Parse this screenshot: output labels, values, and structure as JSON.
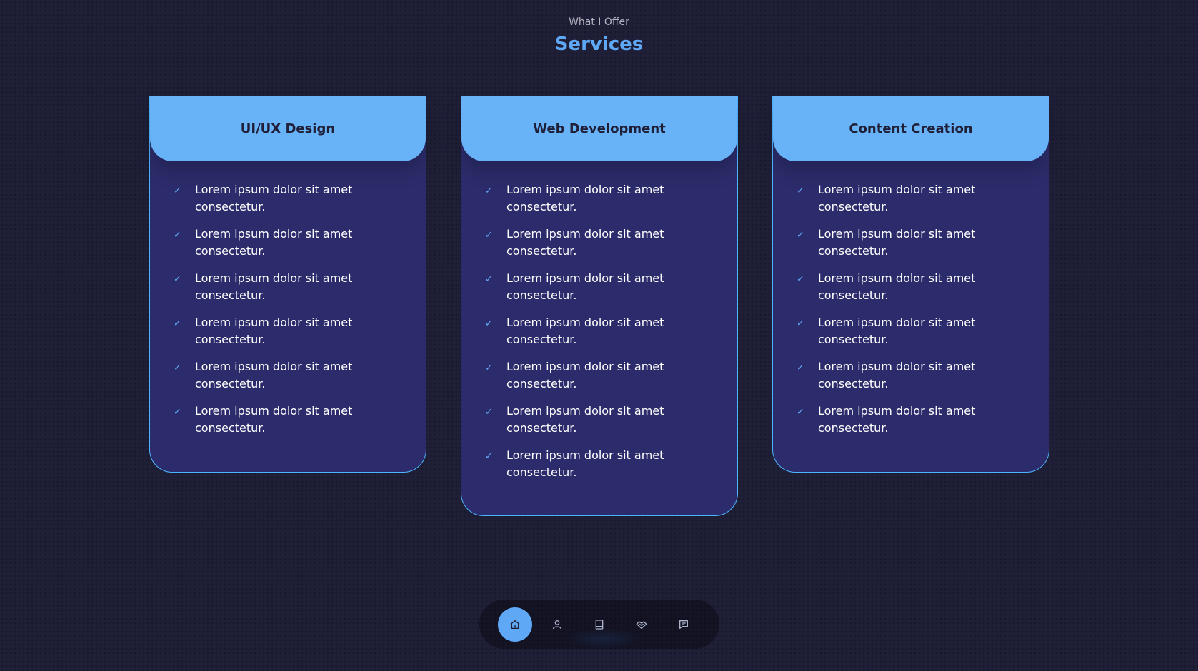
{
  "header": {
    "eyebrow": "What I Offer",
    "title": "Services"
  },
  "cards": [
    {
      "title": "UI/UX Design",
      "items": [
        "Lorem ipsum dolor sit amet consectetur.",
        "Lorem ipsum dolor sit amet consectetur.",
        "Lorem ipsum dolor sit amet consectetur.",
        "Lorem ipsum dolor sit amet consectetur.",
        "Lorem ipsum dolor sit amet consectetur.",
        "Lorem ipsum dolor sit amet consectetur."
      ]
    },
    {
      "title": "Web Development",
      "items": [
        "Lorem ipsum dolor sit amet consectetur.",
        "Lorem ipsum dolor sit amet consectetur.",
        "Lorem ipsum dolor sit amet consectetur.",
        "Lorem ipsum dolor sit amet consectetur.",
        "Lorem ipsum dolor sit amet consectetur.",
        "Lorem ipsum dolor sit amet consectetur.",
        "Lorem ipsum dolor sit amet consectetur."
      ]
    },
    {
      "title": "Content Creation",
      "items": [
        "Lorem ipsum dolor sit amet consectetur.",
        "Lorem ipsum dolor sit amet consectetur.",
        "Lorem ipsum dolor sit amet consectetur.",
        "Lorem ipsum dolor sit amet consectetur.",
        "Lorem ipsum dolor sit amet consectetur.",
        "Lorem ipsum dolor sit amet consectetur."
      ]
    }
  ],
  "nav": {
    "items": [
      "home-icon",
      "user-icon",
      "book-icon",
      "handshake-icon",
      "message-icon"
    ],
    "active": "home-icon"
  },
  "colors": {
    "accent": "#5fa8f5",
    "card_bg": "#2c2c6c",
    "card_head": "#68b2f8",
    "page_bg": "#1f1f38"
  }
}
